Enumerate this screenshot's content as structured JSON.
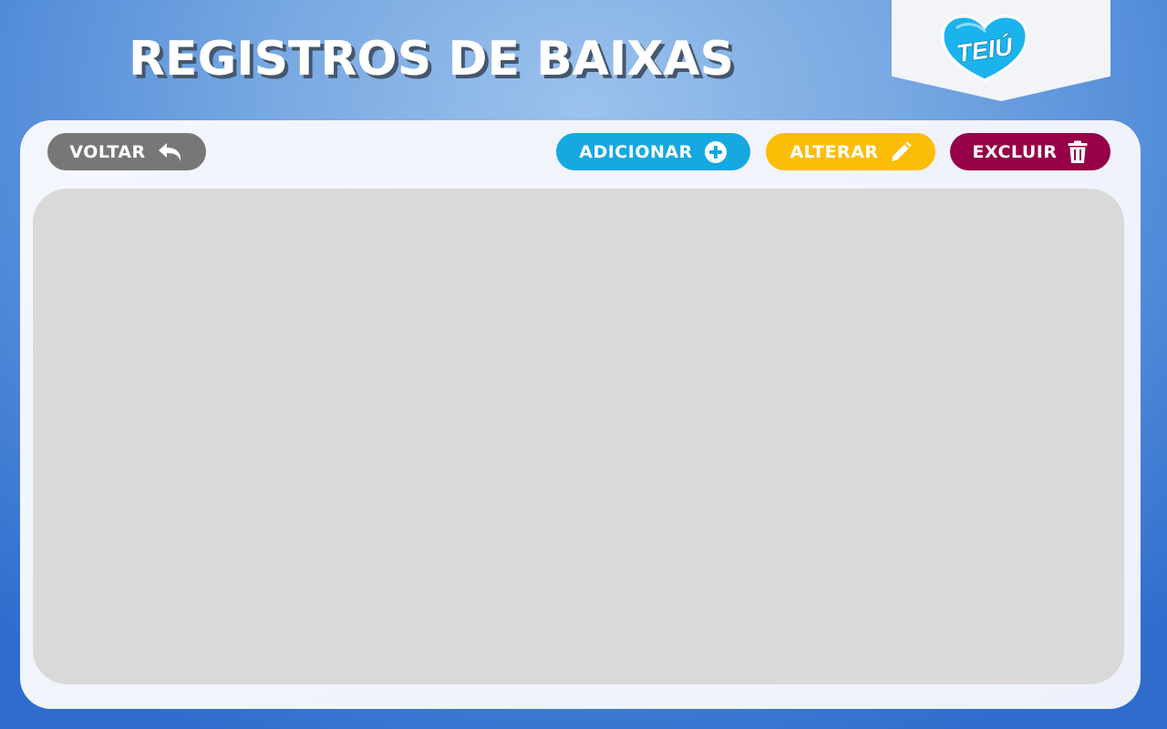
{
  "header": {
    "title": "REGISTROS DE BAIXAS"
  },
  "logo": {
    "text": "TEIÚ",
    "icon": "heart-logo-icon",
    "colors": {
      "primary": "#1bb3ec",
      "outline": "#ffffff"
    }
  },
  "toolbar": {
    "back": {
      "label": "VOLTAR",
      "icon": "back-arrow-icon",
      "color": "#777777"
    },
    "add": {
      "label": "ADICIONAR",
      "icon": "plus-circle-icon",
      "color": "#16a8e0"
    },
    "edit": {
      "label": "ALTERAR",
      "icon": "pencil-icon",
      "color": "#fbbd08"
    },
    "delete": {
      "label": "EXCLUIR",
      "icon": "trash-icon",
      "color": "#960047"
    }
  },
  "content": {
    "background": "#d9d9d9"
  }
}
